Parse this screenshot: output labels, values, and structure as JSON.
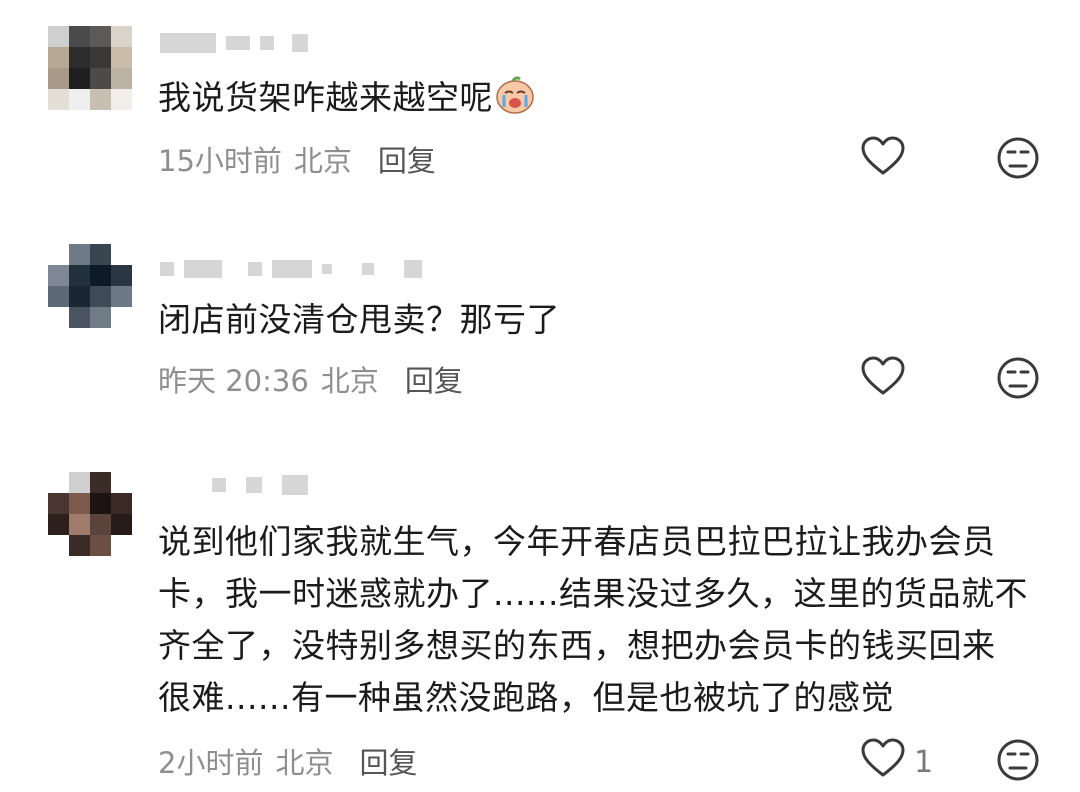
{
  "comments": [
    {
      "text": "我说货架咋越来越空呢",
      "time": "15小时前",
      "location": "北京",
      "reply_label": "回复",
      "like_count": ""
    },
    {
      "text": "闭店前没清仓甩卖？那亏了",
      "time": "昨天 20:36",
      "location": "北京",
      "reply_label": "回复",
      "like_count": ""
    },
    {
      "text": "说到他们家我就生气，今年开春店员巴拉巴拉让我办会员\n卡，我一时迷惑就办了......结果没过多久，这里的货品就不\n齐全了，没特别多想买的东西，想把办会员卡的钱买回来\n很难......有一种虽然没跑路，但是也被坑了的感觉",
      "time": "2小时前",
      "location": "北京",
      "reply_label": "回复",
      "like_count": "1"
    }
  ],
  "icons": {
    "like": "heart-outline-icon",
    "dislike": "neutral-face-icon",
    "emoji": "crying-emoji-icon"
  },
  "colors": {
    "text": "#1b1b1b",
    "meta": "#8f8f8f",
    "reply": "#555555",
    "icon": "#3a3a3a"
  }
}
